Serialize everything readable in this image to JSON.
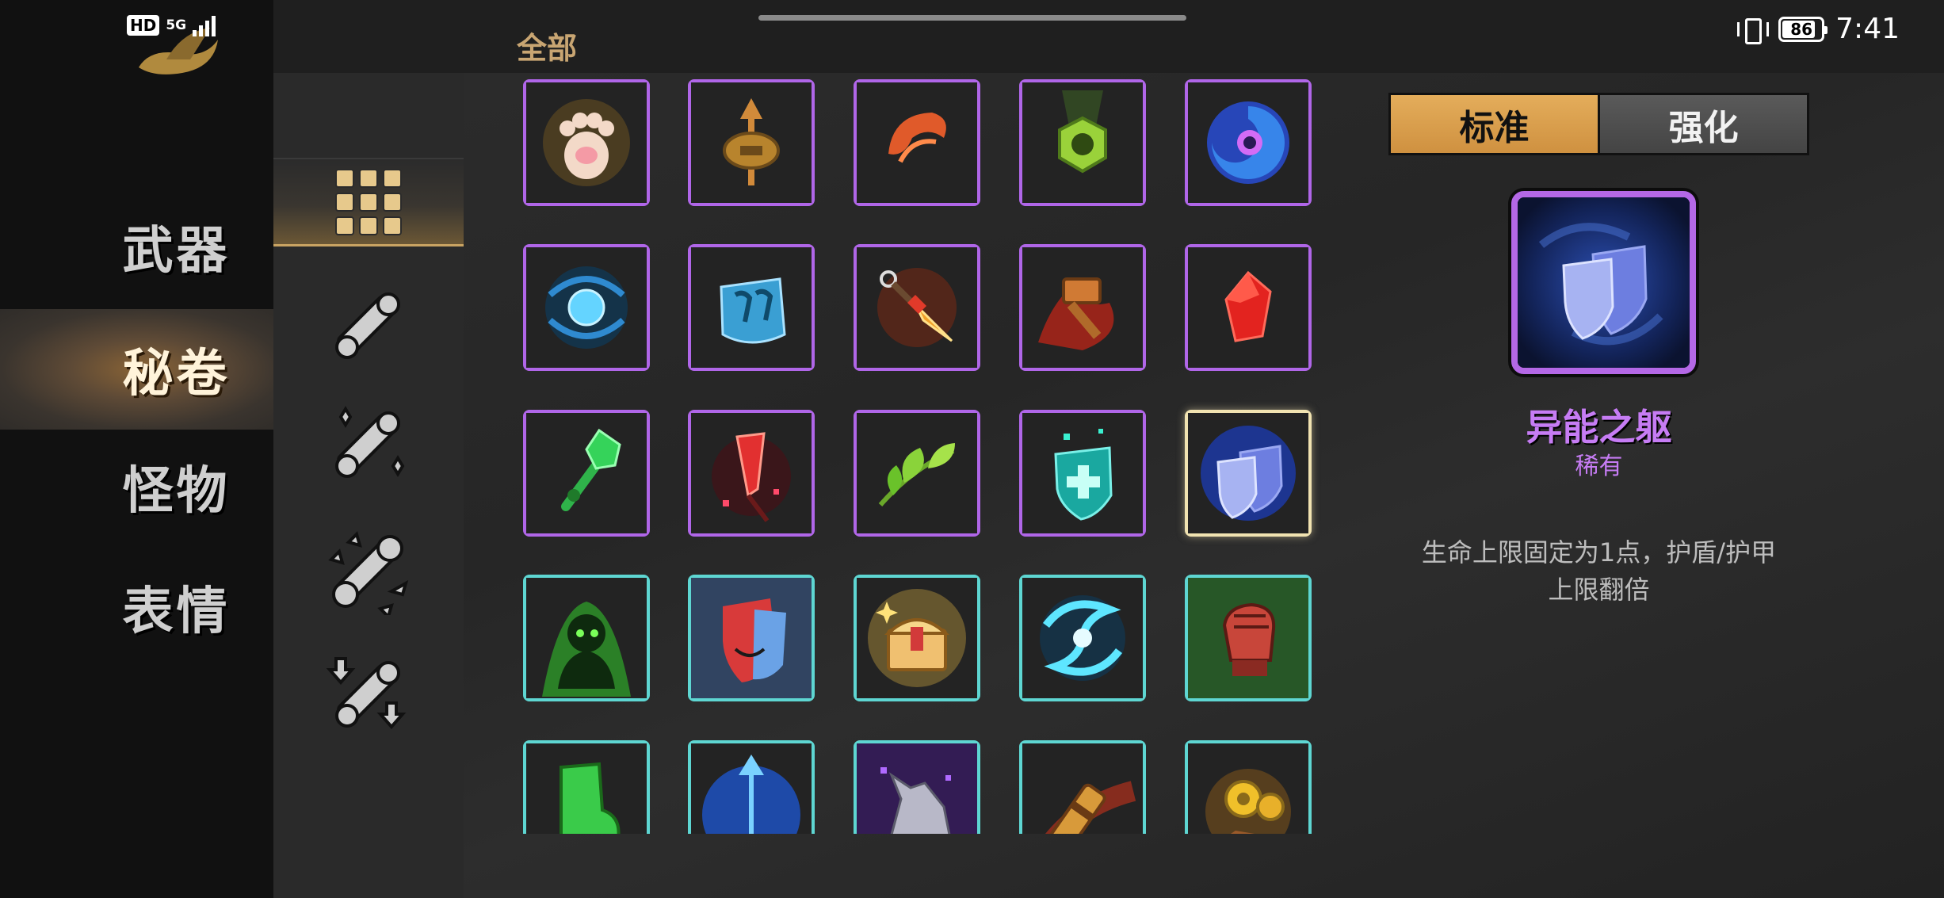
{
  "status_bar": {
    "hd_label": "HD",
    "network_label": "5G",
    "battery_level": "86",
    "battery_fraction": 0.86,
    "time": "7:41"
  },
  "categories": [
    {
      "label": "武器",
      "icon": "weapon",
      "active": false
    },
    {
      "label": "秘卷",
      "icon": "scroll",
      "active": true
    },
    {
      "label": "怪物",
      "icon": "monster",
      "active": false
    },
    {
      "label": "表情",
      "icon": "emote",
      "active": false
    }
  ],
  "subcategories": [
    {
      "icon": "grid-all-icon",
      "active": true
    },
    {
      "icon": "stick-icon",
      "active": false
    },
    {
      "icon": "stick-sparkle-icon",
      "active": false
    },
    {
      "icon": "stick-burst-icon",
      "active": false
    },
    {
      "icon": "stick-arrows-icon",
      "active": false
    }
  ],
  "filter_label": "全部",
  "items": [
    {
      "icon": "cat-paw-icon",
      "rarity": "rare"
    },
    {
      "icon": "coin-arrow-icon",
      "rarity": "rare"
    },
    {
      "icon": "red-claw-icon",
      "rarity": "rare"
    },
    {
      "icon": "green-nut-icon",
      "rarity": "rare"
    },
    {
      "icon": "blue-vortex-icon",
      "rarity": "rare"
    },
    {
      "icon": "water-orb-icon",
      "rarity": "rare"
    },
    {
      "icon": "blue-glove-icon",
      "rarity": "rare"
    },
    {
      "icon": "kunai-icon",
      "rarity": "rare"
    },
    {
      "icon": "fire-hammer-icon",
      "rarity": "rare"
    },
    {
      "icon": "red-gem-icon",
      "rarity": "rare"
    },
    {
      "icon": "green-staff-icon",
      "rarity": "rare"
    },
    {
      "icon": "crimson-dagger-icon",
      "rarity": "rare"
    },
    {
      "icon": "green-leaf-icon",
      "rarity": "rare"
    },
    {
      "icon": "heal-shield-icon",
      "rarity": "rare"
    },
    {
      "icon": "twin-shield-icon",
      "rarity": "rare",
      "selected": true
    },
    {
      "icon": "shadow-figure-icon",
      "rarity": "common"
    },
    {
      "icon": "mask-icon",
      "rarity": "common"
    },
    {
      "icon": "treasure-chest-icon",
      "rarity": "common"
    },
    {
      "icon": "cyan-swirl-icon",
      "rarity": "common"
    },
    {
      "icon": "red-fist-icon",
      "rarity": "common"
    },
    {
      "icon": "green-boot-icon",
      "rarity": "common"
    },
    {
      "icon": "blue-arrow-orb-icon",
      "rarity": "common"
    },
    {
      "icon": "wolf-icon",
      "rarity": "common"
    },
    {
      "icon": "golden-cannon-icon",
      "rarity": "common"
    },
    {
      "icon": "gold-coins-icon",
      "rarity": "common"
    }
  ],
  "detail": {
    "tab_standard": "标准",
    "tab_enhanced": "强化",
    "name": "异能之躯",
    "rarity": "稀有",
    "description_lines": [
      "生命上限固定为1点，护盾/护甲",
      "上限翻倍"
    ]
  },
  "colors": {
    "rare_border": "#b066e8",
    "common_border": "#5ed6d2",
    "selected_border": "#f1e3b1",
    "tab_active": "#d99c4a",
    "accent_text": "#c67cf4",
    "filter_text": "#c8a572"
  }
}
